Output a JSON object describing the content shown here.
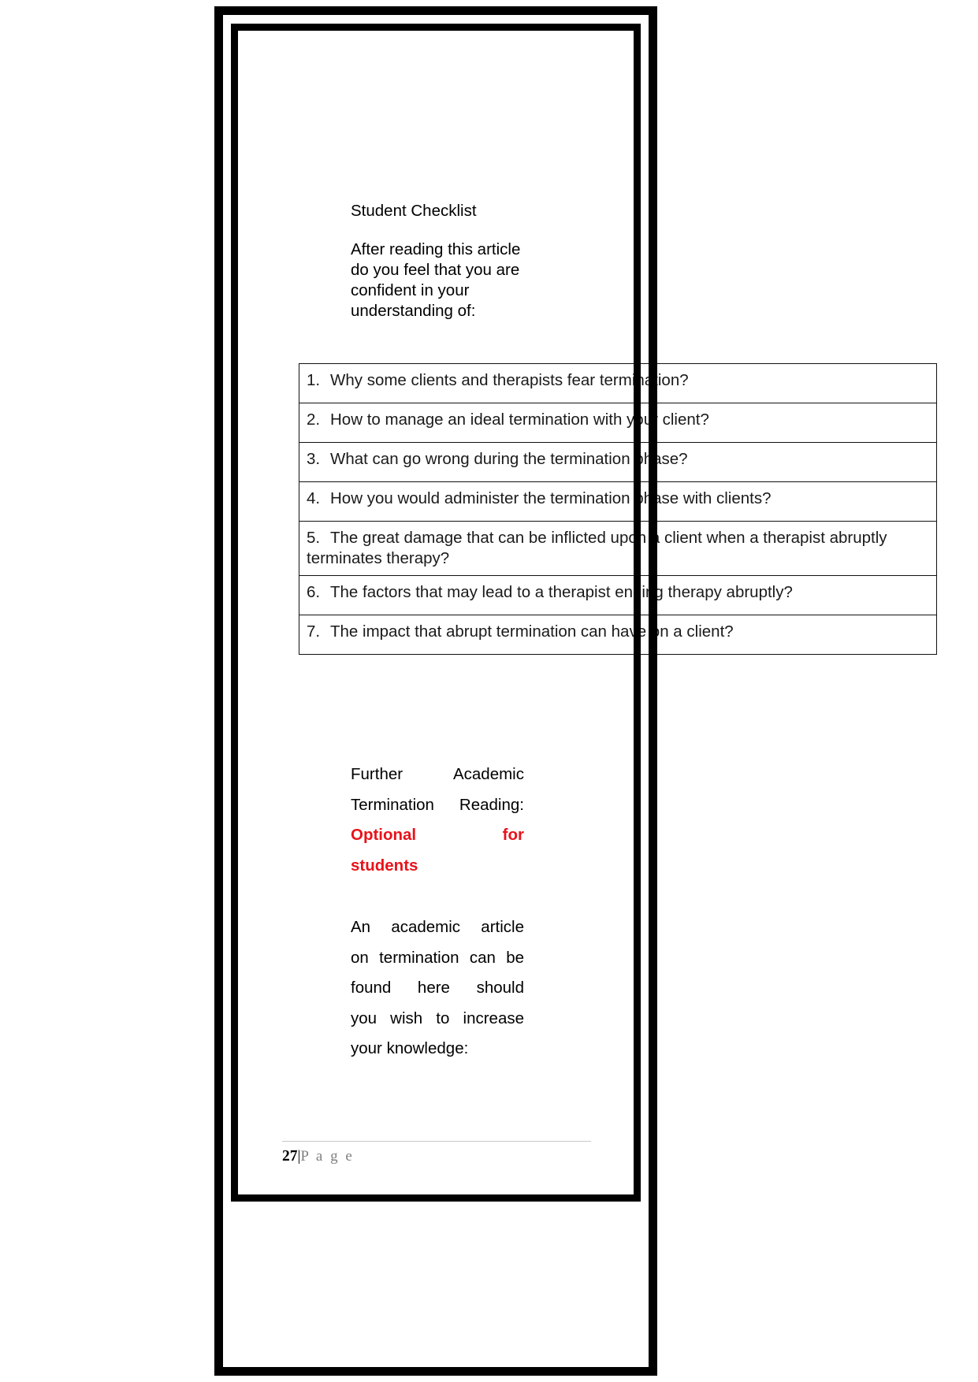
{
  "document": {
    "heading": "Student Checklist",
    "intro": "After reading this article do you feel that you are confident in your understanding of:",
    "checklist": [
      {
        "number": "1.",
        "text": "Why some clients and therapists fear termination?"
      },
      {
        "number": "2.",
        "text": "How to manage an ideal termination with your client?"
      },
      {
        "number": "3.",
        "text": "What can go wrong during the termination phase?"
      },
      {
        "number": "4.",
        "text": "How you would administer the termination phase with clients?"
      },
      {
        "number": "5.",
        "text": "The great damage that can be inflicted upon a client when a therapist abruptly terminates therapy?"
      },
      {
        "number": "6.",
        "text": "The factors that may lead to a therapist ending therapy abruptly?"
      },
      {
        "number": "7.",
        "text": "The impact that abrupt termination can have on a client?"
      }
    ],
    "further_reading": {
      "line1": "Further Academic",
      "line2": "Termination Reading:",
      "highlight_line1": "Optional for",
      "highlight_line2": "students",
      "highlight_color": "#e8131a"
    },
    "academic_note": {
      "line1": "An academic article",
      "line2": "on termination can be",
      "line3": "found here should",
      "line4": "you wish to increase",
      "line5": "your knowledge:"
    },
    "footer": {
      "page_number": "27",
      "separator": "|",
      "page_word": "P a g e"
    }
  }
}
